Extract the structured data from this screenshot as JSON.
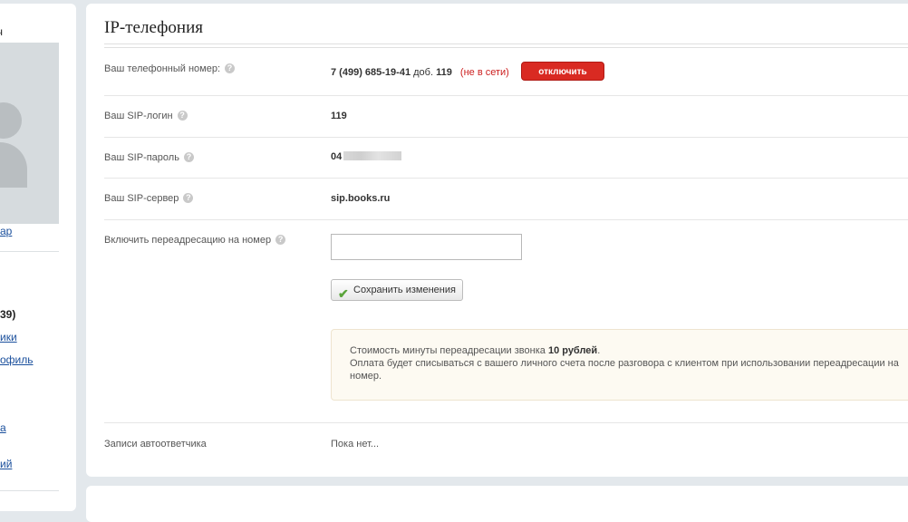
{
  "sidebar": {
    "name_fragment": "ич",
    "photo_link": "ар",
    "count_text": "39)",
    "links": [
      "ики",
      "офиль",
      "а",
      "ий"
    ]
  },
  "ip": {
    "title": "IP-телефония",
    "rows": {
      "phone": {
        "label": "Ваш телефонный номер:",
        "number": "7 (499) 685-19-41",
        "ext_label": "доб.",
        "ext": "119",
        "status": "(не в сети)",
        "disconnect_label": "ОТКЛЮЧИТЬ"
      },
      "login": {
        "label": "Ваш SIP-логин",
        "value": "119"
      },
      "password": {
        "label": "Ваш SIP-пароль",
        "value": "04"
      },
      "server": {
        "label": "Ваш SIP-сервер",
        "value": "sip.books.ru"
      },
      "redirect": {
        "label": "Включить переадресацию на номер",
        "input_value": "",
        "save_label": "Сохранить изменения"
      },
      "voicemail": {
        "label": "Записи автоответчика",
        "value": "Пока нет..."
      }
    },
    "notice": {
      "line1_prefix": "Стоимость минуты переадресации звонка",
      "price": "10 рублей",
      "line1_suffix": ".",
      "line2": "Оплата будет списываться с вашего личного счета после разговора с клиентом при использовании переадресации на",
      "line3": "номер."
    },
    "help_glyph": "?"
  },
  "colors": {
    "background": "#e3e8ec",
    "link": "#1a4f9c",
    "danger": "#d92a22",
    "offline": "#cc1f1f",
    "notice_bg": "#fdfaf2"
  },
  "icons": {
    "help": "question-icon",
    "save": "checkmark-icon",
    "avatar": "user-placeholder-icon"
  }
}
